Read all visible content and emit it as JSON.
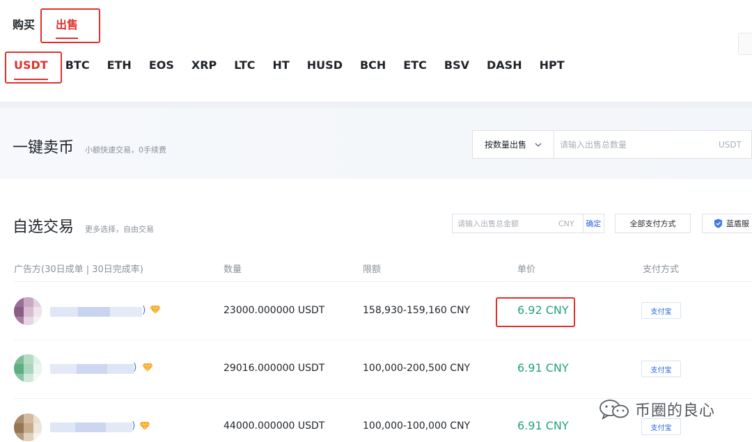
{
  "trade_tabs": {
    "buy": "购买",
    "sell": "出售"
  },
  "coins": [
    "USDT",
    "BTC",
    "ETH",
    "EOS",
    "XRP",
    "LTC",
    "HT",
    "HUSD",
    "BCH",
    "ETC",
    "BSV",
    "DASH",
    "HPT"
  ],
  "quick_sell": {
    "title": "一键卖币",
    "subtitle": "小额快速交易，0手续费",
    "mode": "按数量出售",
    "input_placeholder": "请输入出售总数量",
    "unit": "USDT"
  },
  "self_trade": {
    "title": "自选交易",
    "subtitle": "更多选择，自由交易",
    "amount_placeholder": "请输入出售总金额",
    "amount_unit": "CNY",
    "confirm": "确定",
    "pay_filter": "全部支付方式",
    "shield_filter": "蓝盾服"
  },
  "table": {
    "headers": [
      "广告方(30日成单 | 30日完成率)",
      "数量",
      "限额",
      "单价",
      "支付方式"
    ],
    "rows": [
      {
        "quantity": "23000.000000 USDT",
        "limit": "158,930-159,160 CNY",
        "price": "6.92 CNY",
        "payment": "支付宝"
      },
      {
        "quantity": "29016.000000 USDT",
        "limit": "100,000-200,500 CNY",
        "price": "6.91 CNY",
        "payment": "支付宝"
      },
      {
        "quantity": "44000.000000 USDT",
        "limit": "100,000-100,000 CNY",
        "price": "6.91 CNY",
        "payment": "支付宝"
      }
    ]
  },
  "colors": {
    "accent_red": "#e0302c",
    "price_green": "#1fa37a",
    "link_blue": "#2a66d9"
  },
  "watermark": "币圈的良心"
}
